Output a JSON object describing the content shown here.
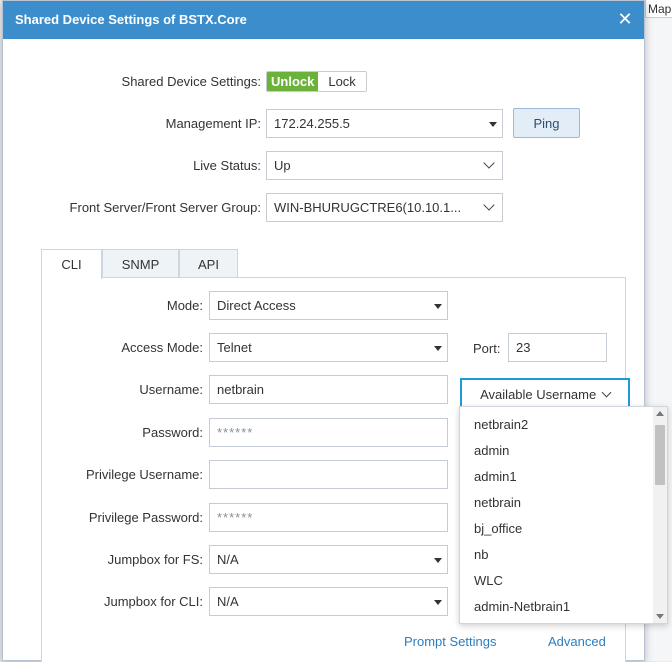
{
  "background": {
    "tab_label": "Map"
  },
  "dialog": {
    "title": "Shared Device Settings of BSTX.Core"
  },
  "settings": {
    "shared_label": "Shared Device Settings:",
    "unlock_label": "Unlock",
    "lock_label": "Lock",
    "mgmt_ip_label": "Management IP:",
    "mgmt_ip_value": "172.24.255.5",
    "ping_label": "Ping",
    "live_status_label": "Live Status:",
    "live_status_value": "Up",
    "front_server_label": "Front Server/Front Server Group:",
    "front_server_value": "WIN-BHURUGCTRE6(10.10.1..."
  },
  "tabs": [
    {
      "label": "CLI",
      "active": true
    },
    {
      "label": "SNMP",
      "active": false
    },
    {
      "label": "API",
      "active": false
    }
  ],
  "cli": {
    "mode_label": "Mode:",
    "mode_value": "Direct Access",
    "access_mode_label": "Access Mode:",
    "access_mode_value": "Telnet",
    "port_label": "Port:",
    "port_value": "23",
    "username_label": "Username:",
    "username_value": "netbrain",
    "available_username_label": "Available Username",
    "password_label": "Password:",
    "password_value": "******",
    "priv_username_label": "Privilege Username:",
    "priv_username_value": "",
    "priv_password_label": "Privilege Password:",
    "priv_password_value": "******",
    "jumpbox_fs_label": "Jumpbox for FS:",
    "jumpbox_fs_value": "N/A",
    "jumpbox_cli_label": "Jumpbox for CLI:",
    "jumpbox_cli_value": "N/A",
    "prompt_settings_label": "Prompt Settings",
    "advanced_label": "Advanced"
  },
  "available_usernames": [
    "netbrain2",
    "admin",
    "admin1",
    "netbrain",
    "bj_office",
    "nb",
    "WLC",
    "admin-Netbrain1"
  ],
  "colors": {
    "titlebar": "#3c8dcb",
    "unlock_active": "#6ab23a",
    "focus_border": "#1f9ad8",
    "link": "#2a7fc1"
  },
  "icons": {
    "close": "close-icon",
    "dropdown": "caret-down-icon",
    "chevron": "chevron-down-icon"
  }
}
